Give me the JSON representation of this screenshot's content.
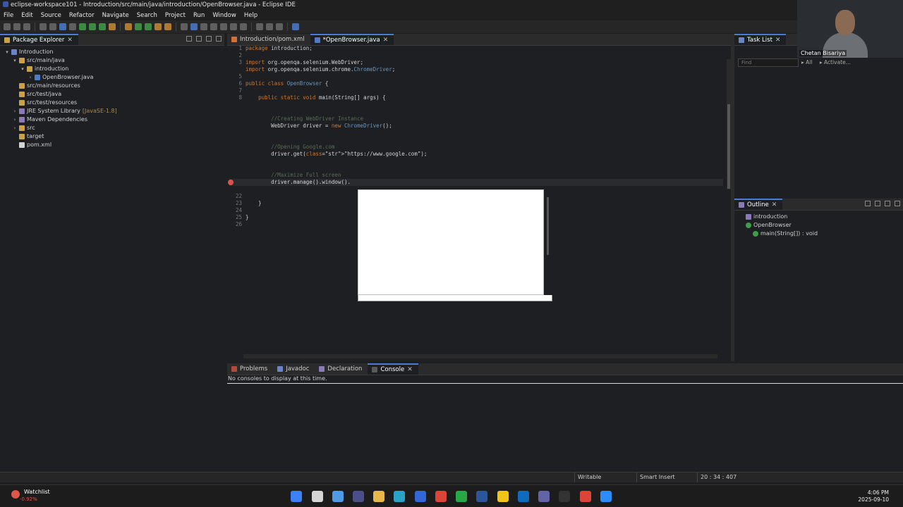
{
  "window": {
    "title": "eclipse-workspace101 - Introduction/src/main/java/introduction/OpenBrowser.java - Eclipse IDE"
  },
  "menu": [
    "File",
    "Edit",
    "Source",
    "Refactor",
    "Navigate",
    "Search",
    "Project",
    "Run",
    "Window",
    "Help"
  ],
  "package_explorer": {
    "tab_label": "Package Explorer",
    "tree": [
      {
        "label": "Introduction",
        "depth": 0,
        "icon": "project-icon",
        "twisty": "down"
      },
      {
        "label": "src/main/java",
        "depth": 1,
        "icon": "source-folder-icon",
        "twisty": "down"
      },
      {
        "label": "introduction",
        "depth": 2,
        "icon": "package-icon",
        "twisty": "down"
      },
      {
        "label": "OpenBrowser.java",
        "depth": 3,
        "icon": "java-file-icon",
        "twisty": "right"
      },
      {
        "label": "src/main/resources",
        "depth": 1,
        "icon": "source-folder-icon",
        "twisty": ""
      },
      {
        "label": "src/test/java",
        "depth": 1,
        "icon": "source-folder-icon",
        "twisty": ""
      },
      {
        "label": "src/test/resources",
        "depth": 1,
        "icon": "source-folder-icon",
        "twisty": ""
      },
      {
        "label": "JRE System Library",
        "suffix": "[JavaSE-1.8]",
        "depth": 1,
        "icon": "library-icon",
        "twisty": "right"
      },
      {
        "label": "Maven Dependencies",
        "depth": 1,
        "icon": "library-icon",
        "twisty": "right"
      },
      {
        "label": "src",
        "depth": 1,
        "icon": "folder-icon",
        "twisty": "right"
      },
      {
        "label": "target",
        "depth": 1,
        "icon": "folder-icon",
        "twisty": ""
      },
      {
        "label": "pom.xml",
        "depth": 1,
        "icon": "xml-file-icon",
        "twisty": ""
      }
    ]
  },
  "editor": {
    "tabs": [
      {
        "label": "Introduction/pom.xml",
        "active": false
      },
      {
        "label": "*OpenBrowser.java",
        "active": true
      }
    ],
    "lines": [
      {
        "n": "1",
        "t": "package introduction;"
      },
      {
        "n": "2",
        "t": ""
      },
      {
        "n": "3",
        "t": "import org.openqa.selenium.WebDriver;"
      },
      {
        "n": "",
        "t": "import org.openqa.selenium.chrome.ChromeDriver;"
      },
      {
        "n": "5",
        "t": ""
      },
      {
        "n": "6",
        "t": "public class OpenBrowser {"
      },
      {
        "n": "7",
        "t": ""
      },
      {
        "n": "8",
        "t": "    public static void main(String[] args) {"
      },
      {
        "n": "",
        "t": ""
      },
      {
        "n": "",
        "t": ""
      },
      {
        "n": "",
        "t": "        //Creating WebDriver Instance"
      },
      {
        "n": "",
        "t": "        WebDriver driver = new ChromeDriver();"
      },
      {
        "n": "",
        "t": ""
      },
      {
        "n": "",
        "t": ""
      },
      {
        "n": "",
        "t": "        //Opening Google.com"
      },
      {
        "n": "",
        "t": "        driver.get(\"https://www.google.com\");"
      },
      {
        "n": "",
        "t": ""
      },
      {
        "n": "",
        "t": ""
      },
      {
        "n": "",
        "t": "        //Maximize Full screen"
      },
      {
        "n": "",
        "t": "        driver.manage().window()."
      },
      {
        "n": "",
        "t": ""
      },
      {
        "n": "22",
        "t": ""
      },
      {
        "n": "23",
        "t": "    }"
      },
      {
        "n": "24",
        "t": ""
      },
      {
        "n": "25",
        "t": "}"
      },
      {
        "n": "26",
        "t": ""
      }
    ]
  },
  "task_list": {
    "tab_label": "Task List",
    "find_placeholder": "Find",
    "all_label": "All",
    "activate_label": "Activate..."
  },
  "outline": {
    "tab_label": "Outline",
    "items": [
      {
        "label": "introduction",
        "depth": 0
      },
      {
        "label": "OpenBrowser",
        "depth": 0
      },
      {
        "label": "main(String[]) : void",
        "depth": 1
      }
    ]
  },
  "bottom_panel": {
    "tabs": [
      {
        "label": "Problems",
        "active": false
      },
      {
        "label": "Javadoc",
        "active": false
      },
      {
        "label": "Declaration",
        "active": false
      },
      {
        "label": "Console",
        "active": true
      }
    ],
    "message": "No consoles to display at this time."
  },
  "status": {
    "writable": "Writable",
    "insert_mode": "Smart Insert",
    "position": "20 : 34 : 407"
  },
  "webcam": {
    "name": "Chetan Bisariya"
  },
  "taskbar": {
    "watch_name": "Watchlist",
    "watch_change": "-0.92%",
    "time": "4:06 PM",
    "date": "2025-09-10"
  },
  "colors": {
    "accent": "#4b7bd6",
    "background": "#1e1f22",
    "keyword": "#cc7832",
    "comment": "#5b6b57"
  }
}
